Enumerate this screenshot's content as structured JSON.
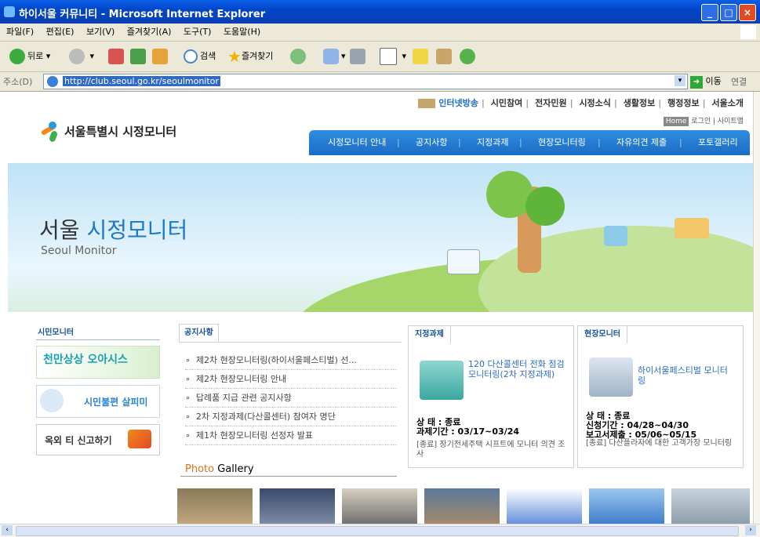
{
  "window": {
    "title": "하이서울 커뮤니티 - Microsoft Internet Explorer"
  },
  "menu": [
    "파일(F)",
    "편집(E)",
    "보기(V)",
    "즐겨찾기(A)",
    "도구(T)",
    "도움말(H)"
  ],
  "toolbar": {
    "back": "뒤로",
    "search": "검색",
    "favorites": "즐겨찾기"
  },
  "address": {
    "label": "주소(D)",
    "url": "http://club.seoul.go.kr/seoulmonitor",
    "go": "이동",
    "links": "연결"
  },
  "site": {
    "logo": "서울특별시 시정모니터",
    "top_links": [
      "인터넷방송",
      "시민참여",
      "전자민원",
      "시정소식",
      "생활정보",
      "행정정보",
      "서울소개"
    ],
    "util": {
      "home": "Home",
      "login": "로그인",
      "sitemap": "사이트맵"
    },
    "gnb": [
      "시정모니터 안내",
      "공지사항",
      "지정과제",
      "현장모니터링",
      "자유의견 제출",
      "포토갤러리"
    ],
    "banner_title_a": "서울",
    "banner_title_b": "시정모니터",
    "banner_sub": "Seoul Monitor",
    "left_title": "시민모니터",
    "left_banners": [
      "천만상상 오아시스",
      "시민불편 살피미",
      "옥외 티 신고하기"
    ],
    "notice": {
      "title": "공지사항",
      "items": [
        "제2차 현장모니터링(하이서울페스티벌) 선...",
        "제2차 현장모니터링 안내",
        "답례품 지급 관련 공지사항",
        "2차 지정과제(다산콜센터) 참여자 명단",
        "제1차 현장모니터링 선정자 발표"
      ]
    },
    "task": {
      "title": "지정과제",
      "headline": "120 다산콜센터 전화 점검 모니터링(2차 지정과제)",
      "status": "상 태 : 종료",
      "period": "과제기간 : 03/17~03/24",
      "prev": "[종료] 장기전세주택 시프트에 모니터 의견 조사"
    },
    "field": {
      "title": "현장모니터",
      "headline": "하이서울페스티벌 모니터링",
      "status": "상 태 : 종료",
      "apply": "신청기간 : 04/28~04/30",
      "report": "보고서제출 : 05/06~05/15",
      "prev": "[종료] 다산플라자에 대한 고객가장 모니터링"
    },
    "gallery_a": "Photo",
    "gallery_b": " Gallery"
  },
  "colors": {
    "accent": "#1b6dc4",
    "title_bar": "#0a5fe6",
    "orange": "#e0701a"
  }
}
